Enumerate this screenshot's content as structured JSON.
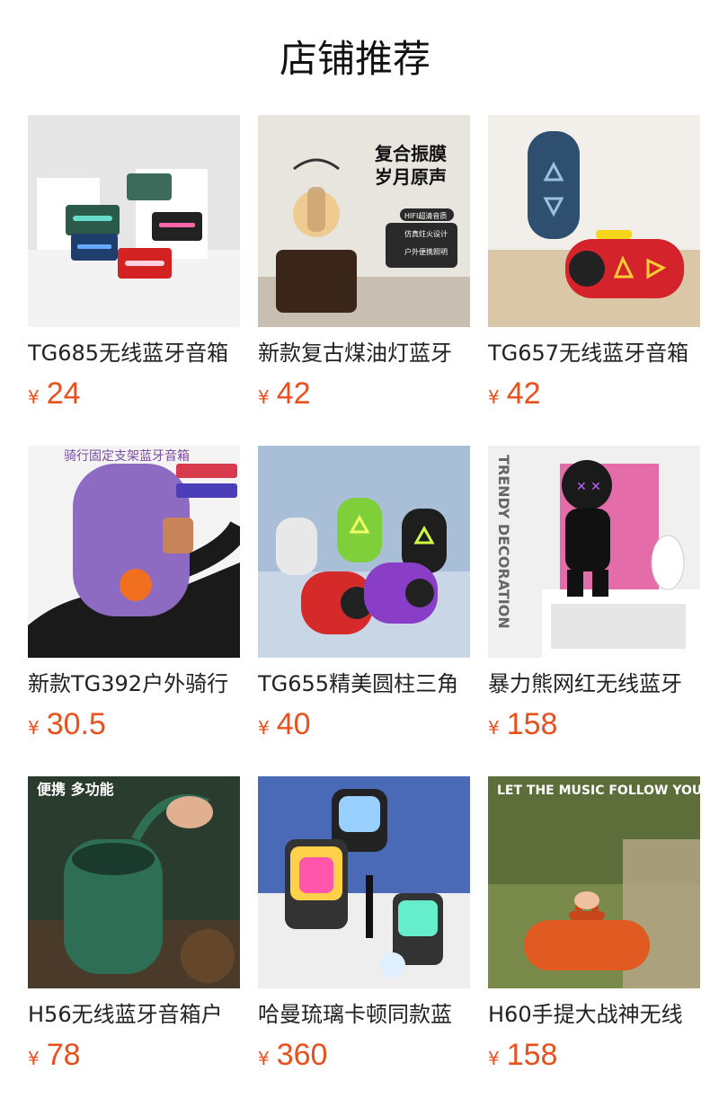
{
  "section_title": "店铺推荐",
  "currency_symbol": "¥",
  "products": [
    {
      "name": "TG685无线蓝牙音箱",
      "price": "24",
      "overlay": ""
    },
    {
      "name": "新款复古煤油灯蓝牙",
      "price": "42",
      "overlay": "复合振膜\n岁月原声",
      "tags": [
        "HIFI超清音质",
        "仿真炷火设计",
        "户外便携照明"
      ]
    },
    {
      "name": "TG657无线蓝牙音箱",
      "price": "42",
      "overlay": ""
    },
    {
      "name": "新款TG392户外骑行",
      "price": "30.5",
      "overlay": "骑行固定支架蓝牙音箱"
    },
    {
      "name": "TG655精美圆柱三角",
      "price": "40",
      "overlay": ""
    },
    {
      "name": "暴力熊网红无线蓝牙",
      "price": "158",
      "overlay": "TRENDY DECORATION"
    },
    {
      "name": "H56无线蓝牙音箱户",
      "price": "78",
      "overlay": "便携  多功能"
    },
    {
      "name": "哈曼琉璃卡顿同款蓝",
      "price": "360",
      "overlay": ""
    },
    {
      "name": "H60手提大战神无线",
      "price": "158",
      "overlay": "LET THE MUSIC FOLLOW YOU"
    }
  ],
  "colors": {
    "price": "#e8501e",
    "title": "#111111",
    "name": "#222222"
  }
}
